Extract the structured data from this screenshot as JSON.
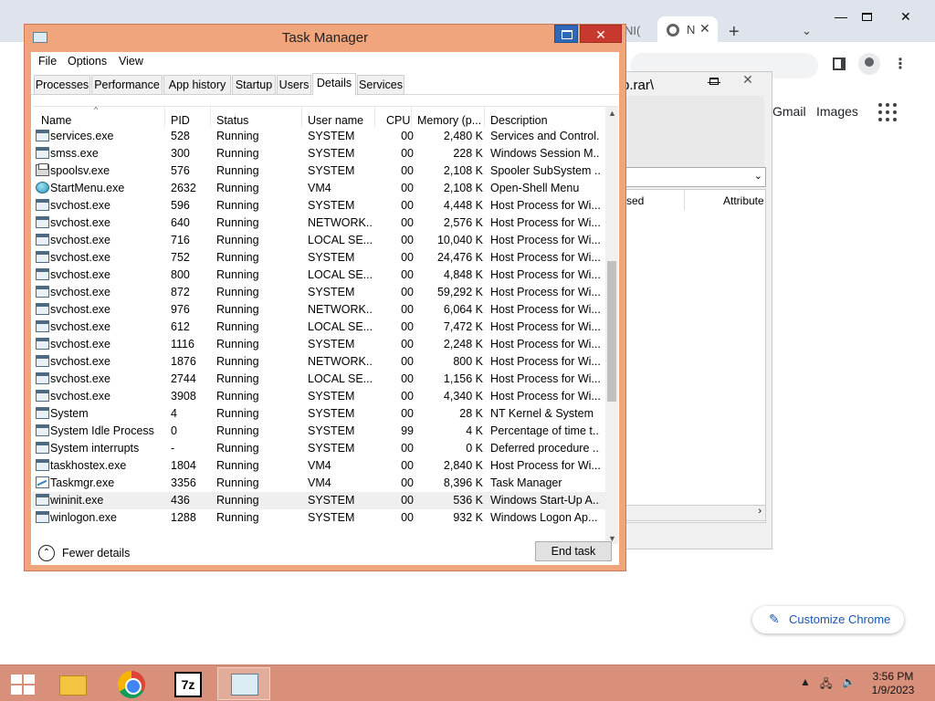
{
  "chrome": {
    "tab_partial": "NI(",
    "tab_active_title": "N",
    "tab_close": "✕",
    "new_tab": "+",
    "tab_search": "⌄",
    "window_min": "—",
    "window_close": "✕",
    "kebab": "⋮",
    "links": {
      "gmail": "Gmail",
      "images": "Images"
    },
    "customize_label": "Customize Chrome",
    "customize_icon": "✎"
  },
  "zip": {
    "title_fragment": "p.rar\\",
    "min": "—",
    "close": "✕",
    "combo_chevron": "⌄",
    "col_used": "sed",
    "col_attrib": "Attribute",
    "scroll_right": "›"
  },
  "taskmanager": {
    "title": "Task Manager",
    "min": "—",
    "close": "✕",
    "menu": [
      "File",
      "Options",
      "View"
    ],
    "tabs": [
      "Processes",
      "Performance",
      "App history",
      "Startup",
      "Users",
      "Details",
      "Services"
    ],
    "active_tab": "Details",
    "columns": [
      "Name",
      "PID",
      "Status",
      "User name",
      "CPU",
      "Memory (p...",
      "Description"
    ],
    "sort_caret": "^",
    "rows": [
      {
        "icon": "process",
        "name": "services.exe",
        "pid": "528",
        "status": "Running",
        "user": "SYSTEM",
        "cpu": "00",
        "mem": "2,480 K",
        "desc": "Services and Control..."
      },
      {
        "icon": "process",
        "name": "smss.exe",
        "pid": "300",
        "status": "Running",
        "user": "SYSTEM",
        "cpu": "00",
        "mem": "228 K",
        "desc": "Windows Session M..."
      },
      {
        "icon": "printer",
        "name": "spoolsv.exe",
        "pid": "576",
        "status": "Running",
        "user": "SYSTEM",
        "cpu": "00",
        "mem": "2,108 K",
        "desc": "Spooler SubSystem ..."
      },
      {
        "icon": "globe",
        "name": "StartMenu.exe",
        "pid": "2632",
        "status": "Running",
        "user": "VM4",
        "cpu": "00",
        "mem": "2,108 K",
        "desc": "Open-Shell Menu"
      },
      {
        "icon": "process",
        "name": "svchost.exe",
        "pid": "596",
        "status": "Running",
        "user": "SYSTEM",
        "cpu": "00",
        "mem": "4,448 K",
        "desc": "Host Process for Wi..."
      },
      {
        "icon": "process",
        "name": "svchost.exe",
        "pid": "640",
        "status": "Running",
        "user": "NETWORK...",
        "cpu": "00",
        "mem": "2,576 K",
        "desc": "Host Process for Wi..."
      },
      {
        "icon": "process",
        "name": "svchost.exe",
        "pid": "716",
        "status": "Running",
        "user": "LOCAL SE...",
        "cpu": "00",
        "mem": "10,040 K",
        "desc": "Host Process for Wi..."
      },
      {
        "icon": "process",
        "name": "svchost.exe",
        "pid": "752",
        "status": "Running",
        "user": "SYSTEM",
        "cpu": "00",
        "mem": "24,476 K",
        "desc": "Host Process for Wi..."
      },
      {
        "icon": "process",
        "name": "svchost.exe",
        "pid": "800",
        "status": "Running",
        "user": "LOCAL SE...",
        "cpu": "00",
        "mem": "4,848 K",
        "desc": "Host Process for Wi..."
      },
      {
        "icon": "process",
        "name": "svchost.exe",
        "pid": "872",
        "status": "Running",
        "user": "SYSTEM",
        "cpu": "00",
        "mem": "59,292 K",
        "desc": "Host Process for Wi..."
      },
      {
        "icon": "process",
        "name": "svchost.exe",
        "pid": "976",
        "status": "Running",
        "user": "NETWORK...",
        "cpu": "00",
        "mem": "6,064 K",
        "desc": "Host Process for Wi..."
      },
      {
        "icon": "process",
        "name": "svchost.exe",
        "pid": "612",
        "status": "Running",
        "user": "LOCAL SE...",
        "cpu": "00",
        "mem": "7,472 K",
        "desc": "Host Process for Wi..."
      },
      {
        "icon": "process",
        "name": "svchost.exe",
        "pid": "1116",
        "status": "Running",
        "user": "SYSTEM",
        "cpu": "00",
        "mem": "2,248 K",
        "desc": "Host Process for Wi..."
      },
      {
        "icon": "process",
        "name": "svchost.exe",
        "pid": "1876",
        "status": "Running",
        "user": "NETWORK...",
        "cpu": "00",
        "mem": "800 K",
        "desc": "Host Process for Wi..."
      },
      {
        "icon": "process",
        "name": "svchost.exe",
        "pid": "2744",
        "status": "Running",
        "user": "LOCAL SE...",
        "cpu": "00",
        "mem": "1,156 K",
        "desc": "Host Process for Wi..."
      },
      {
        "icon": "process",
        "name": "svchost.exe",
        "pid": "3908",
        "status": "Running",
        "user": "SYSTEM",
        "cpu": "00",
        "mem": "4,340 K",
        "desc": "Host Process for Wi..."
      },
      {
        "icon": "process",
        "name": "System",
        "pid": "4",
        "status": "Running",
        "user": "SYSTEM",
        "cpu": "00",
        "mem": "28 K",
        "desc": "NT Kernel & System"
      },
      {
        "icon": "process",
        "name": "System Idle Process",
        "pid": "0",
        "status": "Running",
        "user": "SYSTEM",
        "cpu": "99",
        "mem": "4 K",
        "desc": "Percentage of time t..."
      },
      {
        "icon": "process",
        "name": "System interrupts",
        "pid": "-",
        "status": "Running",
        "user": "SYSTEM",
        "cpu": "00",
        "mem": "0 K",
        "desc": "Deferred procedure ..."
      },
      {
        "icon": "process",
        "name": "taskhostex.exe",
        "pid": "1804",
        "status": "Running",
        "user": "VM4",
        "cpu": "00",
        "mem": "2,840 K",
        "desc": "Host Process for Wi..."
      },
      {
        "icon": "graph",
        "name": "Taskmgr.exe",
        "pid": "3356",
        "status": "Running",
        "user": "VM4",
        "cpu": "00",
        "mem": "8,396 K",
        "desc": "Task Manager"
      },
      {
        "icon": "process",
        "name": "wininit.exe",
        "pid": "436",
        "status": "Running",
        "user": "SYSTEM",
        "cpu": "00",
        "mem": "536 K",
        "desc": "Windows Start-Up A...",
        "selected": true
      },
      {
        "icon": "process",
        "name": "winlogon.exe",
        "pid": "1288",
        "status": "Running",
        "user": "SYSTEM",
        "cpu": "00",
        "mem": "932 K",
        "desc": "Windows Logon Ap..."
      }
    ],
    "scroll": {
      "up": "▲",
      "down": "▼",
      "thumb_position": 0.52,
      "thumb_size": 0.34
    },
    "fewer_details_label": "Fewer details",
    "fewer_icon": "⌃",
    "end_task_label": "End task"
  },
  "taskbar": {
    "apps": [
      "file-explorer",
      "chrome",
      "7zip",
      "task-manager"
    ],
    "sevenzip_label": "7z",
    "tray_arrow": "▲",
    "tray_network": "🖧",
    "tray_volume": "🔈",
    "time": "3:56 PM",
    "date": "1/9/2023"
  }
}
